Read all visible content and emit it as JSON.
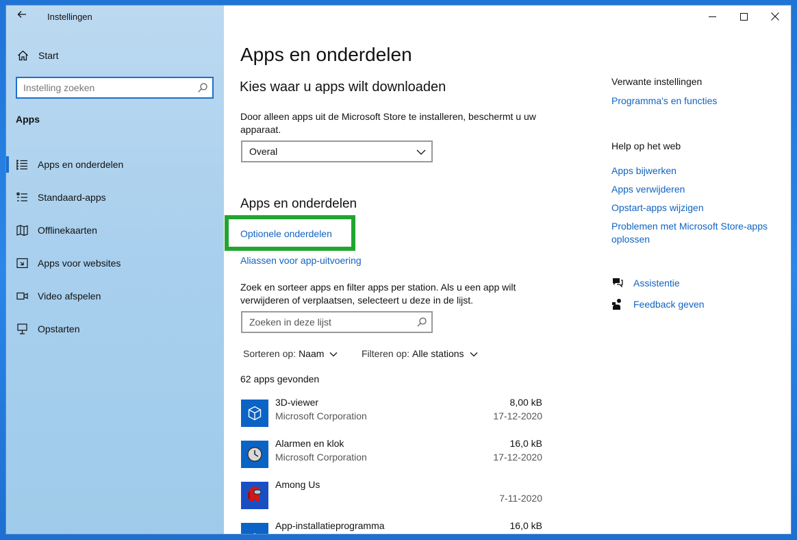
{
  "window": {
    "title": "Instellingen"
  },
  "sidebar": {
    "home_label": "Start",
    "search_placeholder": "Instelling zoeken",
    "section": "Apps",
    "items": [
      {
        "label": "Apps en onderdelen",
        "icon": "apps-list-icon",
        "active": true
      },
      {
        "label": "Standaard-apps",
        "icon": "default-apps-icon",
        "active": false
      },
      {
        "label": "Offlinekaarten",
        "icon": "map-icon",
        "active": false
      },
      {
        "label": "Apps voor websites",
        "icon": "website-icon",
        "active": false
      },
      {
        "label": "Video afspelen",
        "icon": "video-icon",
        "active": false
      },
      {
        "label": "Opstarten",
        "icon": "startup-icon",
        "active": false
      }
    ]
  },
  "main": {
    "title": "Apps en onderdelen",
    "download": {
      "heading": "Kies waar u apps wilt downloaden",
      "description": "Door alleen apps uit de Microsoft Store te installeren, beschermt u uw apparaat.",
      "selected": "Overal"
    },
    "apps": {
      "heading": "Apps en onderdelen",
      "optional_link": "Optionele onderdelen",
      "alias_link": "Aliassen voor app-uitvoering",
      "filter_description": "Zoek en sorteer apps en filter apps per station. Als u een app wilt verwijderen of verplaatsen, selecteert u deze in de lijst.",
      "search_placeholder": "Zoeken in deze lijst",
      "sort_label": "Sorteren op:",
      "sort_value": "Naam",
      "filter_label": "Filteren op:",
      "filter_value": "Alle stations",
      "count": "62 apps gevonden",
      "list": [
        {
          "name": "3D-viewer",
          "publisher": "Microsoft Corporation",
          "size": "8,00 kB",
          "date": "17-12-2020",
          "icon": "cube-icon",
          "color": "#0b63c5"
        },
        {
          "name": "Alarmen en klok",
          "publisher": "Microsoft Corporation",
          "size": "16,0 kB",
          "date": "17-12-2020",
          "icon": "clock-icon",
          "color": "#0b63c5"
        },
        {
          "name": "Among Us",
          "publisher": "",
          "size": "",
          "date": "7-11-2020",
          "icon": "among-us-icon",
          "color": "#1a4fc4"
        },
        {
          "name": "App-installatieprogramma",
          "publisher": "",
          "size": "16,0 kB",
          "date": "",
          "icon": "installer-icon",
          "color": "#0b63c5"
        }
      ]
    }
  },
  "related": {
    "heading": "Verwante instellingen",
    "links": [
      "Programma's en functies"
    ]
  },
  "web_help": {
    "heading": "Help op het web",
    "links": [
      "Apps bijwerken",
      "Apps verwijderen",
      "Opstart-apps wijzigen",
      "Problemen met Microsoft Store-apps oplossen"
    ]
  },
  "support": {
    "assist": "Assistentie",
    "feedback": "Feedback geven"
  },
  "colors": {
    "accent": "#1063c1",
    "highlight": "#21a530"
  }
}
